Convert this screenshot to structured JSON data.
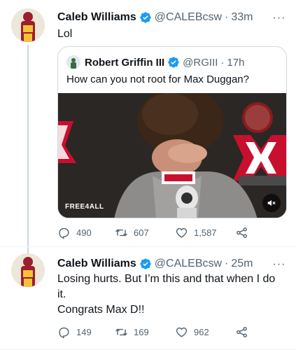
{
  "tweets": [
    {
      "author_name": "Caleb Williams",
      "handle": "@CALEBcsw",
      "separator": "·",
      "time": "33m",
      "text_lines": [
        "Lol"
      ],
      "quoted": {
        "author_name": "Robert Griffin III",
        "handle": "@RGIII",
        "separator": "·",
        "time": "17h",
        "text": "How can you not root for Max Duggan?",
        "media_badge": "FREE4ALL",
        "media_icon": "mute-speaker-icon"
      },
      "actions": {
        "replies": "490",
        "retweets": "607",
        "likes": "1,587"
      }
    },
    {
      "author_name": "Caleb Williams",
      "handle": "@CALEBcsw",
      "separator": "·",
      "time": "25m",
      "text_lines": [
        "Losing hurts. But I’m this and that when I do",
        "it.",
        "Congrats Max D!!"
      ],
      "actions": {
        "replies": "149",
        "retweets": "169",
        "likes": "962"
      }
    }
  ],
  "colors": {
    "verified": "#1d9bf0",
    "muted_text": "#536471",
    "primary_text": "#0f1419",
    "border": "#cfd9de"
  }
}
